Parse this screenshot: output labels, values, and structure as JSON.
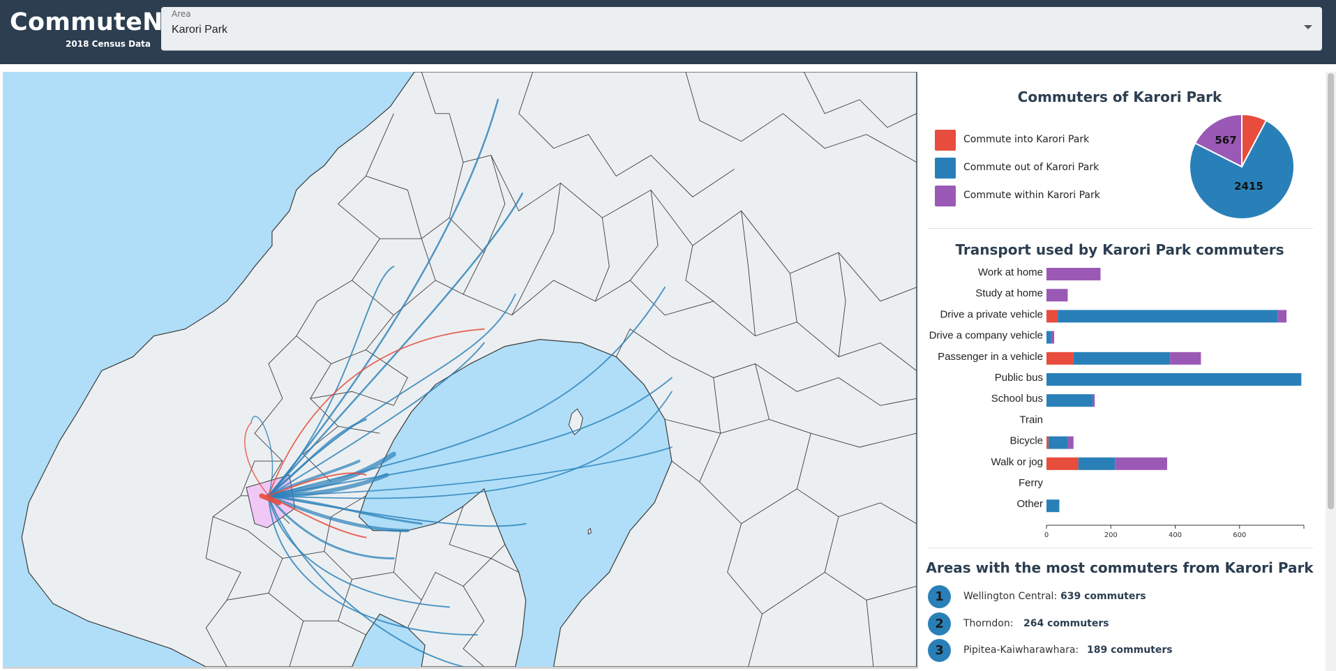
{
  "header": {
    "app_title": "CommuteNZ",
    "subtitle": "2018 Census Data",
    "area_select": {
      "label": "Area",
      "value": "Karori Park"
    }
  },
  "colors": {
    "header_bg": "#2c3e50",
    "water": "#b0def8",
    "land": "#eceff1",
    "into": "#e74c3c",
    "out": "#2980b9",
    "within": "#9b59b6",
    "selected_area": "#f0c8f5"
  },
  "map": {
    "selected_area": "Karori Park"
  },
  "pie_section": {
    "title": "Commuters of Karori Park",
    "legend": [
      {
        "label": "Commute into Karori Park",
        "color": "#e74c3c"
      },
      {
        "label": "Commute out of Karori Park",
        "color": "#2980b9"
      },
      {
        "label": "Commute within Karori Park",
        "color": "#9b59b6"
      }
    ],
    "visible_labels": {
      "within": "567",
      "out": "2415"
    }
  },
  "transport_section": {
    "title": "Transport used by Karori Park commuters"
  },
  "chart_data": [
    {
      "type": "pie",
      "title": "Commuters of Karori Park",
      "categories": [
        "Commute into Karori Park",
        "Commute out of Karori Park",
        "Commute within Karori Park"
      ],
      "values": [
        250,
        2415,
        567
      ],
      "colors": [
        "#e74c3c",
        "#2980b9",
        "#9b59b6"
      ]
    },
    {
      "type": "bar",
      "orientation": "horizontal",
      "stacked": true,
      "title": "Transport used by Karori Park commuters",
      "categories": [
        "Work at home",
        "Study at home",
        "Drive a private vehicle",
        "Drive a company vehicle",
        "Passenger in a vehicle",
        "Public bus",
        "School bus",
        "Train",
        "Bicycle",
        "Walk or jog",
        "Ferry",
        "Other"
      ],
      "series": [
        {
          "color": "#e74c3c",
          "values": [
            0,
            0,
            35,
            0,
            84,
            0,
            0,
            0,
            6,
            99,
            0,
            0
          ]
        },
        {
          "color": "#2980b9",
          "values": [
            0,
            0,
            684,
            15,
            300,
            792,
            144,
            0,
            60,
            114,
            0,
            40
          ]
        },
        {
          "color": "#9b59b6",
          "values": [
            168,
            66,
            27,
            9,
            96,
            0,
            6,
            0,
            18,
            162,
            0,
            0
          ]
        }
      ],
      "xticks": [
        0,
        200,
        400,
        600
      ],
      "xlim": [
        0,
        800
      ]
    }
  ],
  "top_areas": {
    "title": "Areas with the most commuters from Karori Park",
    "items": [
      {
        "rank": "1",
        "name": "Wellington Central:",
        "count": "639 commuters"
      },
      {
        "rank": "2",
        "name": "Thorndon:",
        "count": "264 commuters"
      },
      {
        "rank": "3",
        "name": "Pipitea-Kaiwharawhara:",
        "count": "189 commuters"
      }
    ]
  }
}
